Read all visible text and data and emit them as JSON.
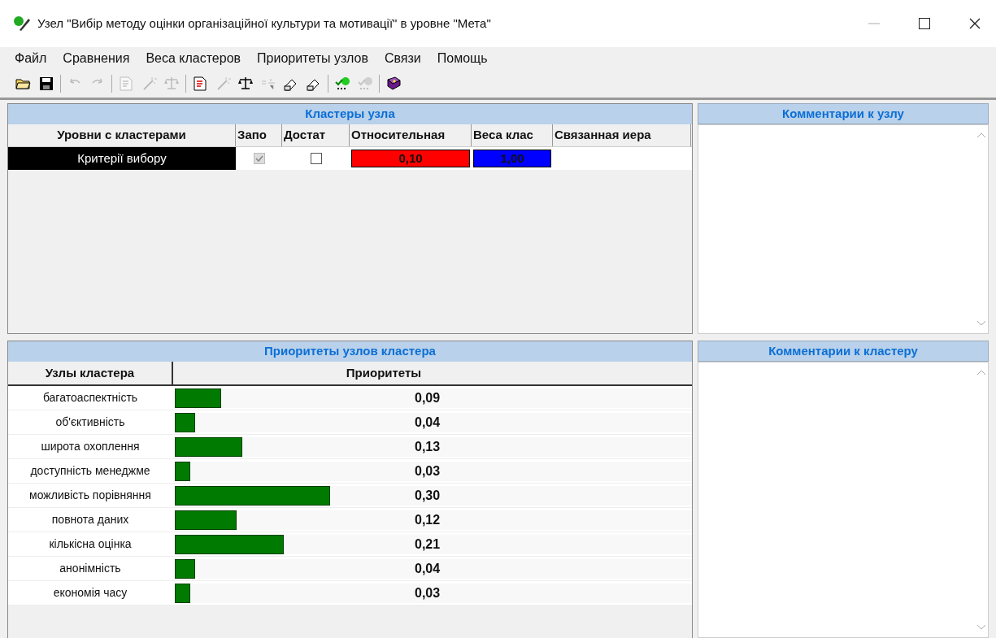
{
  "window": {
    "title": "Узел \"Вибір методу оцінки організаційної культури та мотивації\" в уровне \"Мета\""
  },
  "menu": [
    "Файл",
    "Сравнения",
    "Веса кластеров",
    "Приоритеты узлов",
    "Связи",
    "Помощь"
  ],
  "toolbar": [
    [
      {
        "disabled": false
      },
      {
        "disabled": false
      }
    ],
    [
      {
        "disabled": true
      },
      {
        "disabled": true
      }
    ],
    [
      {
        "disabled": true
      },
      {
        "disabled": true
      },
      {
        "disabled": true
      }
    ],
    [
      {
        "disabled": false
      },
      {
        "disabled": true
      },
      {
        "disabled": false
      },
      {
        "disabled": true
      },
      {
        "disabled": false
      },
      {
        "disabled": false
      }
    ],
    [
      {
        "disabled": false
      },
      {
        "disabled": true
      }
    ],
    [
      {
        "disabled": false
      }
    ]
  ],
  "clusters": {
    "title": "Кластеры узла",
    "columns": [
      "Уровни с кластерами",
      "Запо",
      "Достат",
      "Относительная",
      "Веса клас",
      "Связанная иера"
    ],
    "rows": [
      {
        "name": "Критерії вибору",
        "filled": {
          "checked": true,
          "disabled": true
        },
        "enough": {
          "checked": false,
          "disabled": false
        },
        "relative": "0,10",
        "weight": "1,00"
      }
    ]
  },
  "node_comments": {
    "title": "Комментарии к узлу"
  },
  "priorities": {
    "title": "Приоритеты узлов кластера",
    "columns": [
      "Узлы кластера",
      "Приоритеты"
    ],
    "rows": [
      {
        "name": "багатоаспектність",
        "level": 0.09,
        "value": "0,09"
      },
      {
        "name": "об'єктивність",
        "level": 0.04,
        "value": "0,04"
      },
      {
        "name": "широта охоплення",
        "level": 0.13,
        "value": "0,13"
      },
      {
        "name": "доступність менеджме",
        "level": 0.03,
        "value": "0,03"
      },
      {
        "name": "можливість порівняння",
        "level": 0.3,
        "value": "0,30"
      },
      {
        "name": "повнота даних",
        "level": 0.12,
        "value": "0,12"
      },
      {
        "name": "кількісна оцінка",
        "level": 0.21,
        "value": "0,21"
      },
      {
        "name": "анонімність",
        "level": 0.04,
        "value": "0,04"
      },
      {
        "name": "економія часу",
        "level": 0.03,
        "value": "0,03"
      }
    ]
  },
  "cluster_comments": {
    "title": "Комментарии к кластеру"
  }
}
